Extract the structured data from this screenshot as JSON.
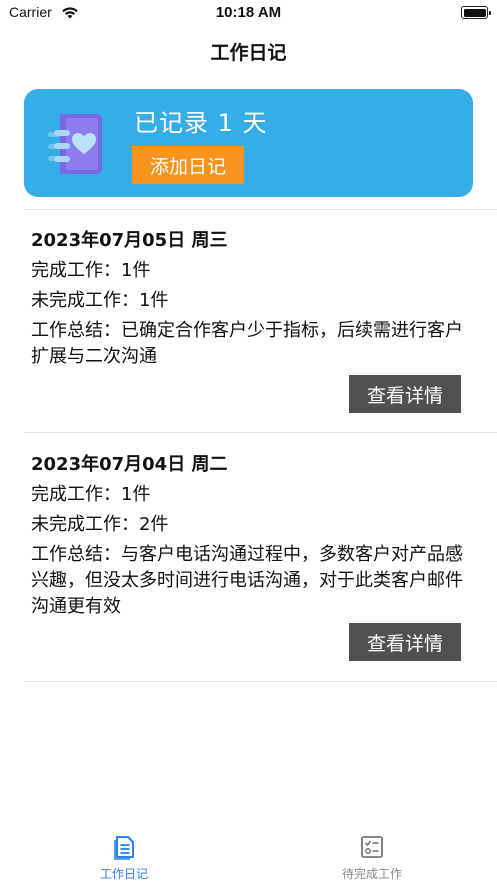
{
  "status_bar": {
    "carrier": "Carrier",
    "time": "10:18 AM"
  },
  "nav": {
    "title": "工作日记"
  },
  "banner": {
    "title": "已记录 1 天",
    "add_button": "添加日记",
    "icon": "notebook-heart-icon"
  },
  "entries": [
    {
      "date": "2023年07月05日 周三",
      "completed": "完成工作：1件",
      "uncompleted": "未完成工作：1件",
      "summary": "工作总结：已确定合作客户少于指标，后续需进行客户扩展与二次沟通",
      "detail_button": "查看详情"
    },
    {
      "date": "2023年07月04日 周二",
      "completed": "完成工作：1件",
      "uncompleted": "未完成工作：2件",
      "summary": "工作总结：与客户电话沟通过程中，多数客户对产品感兴趣，但没太多时间进行电话沟通，对于此类客户邮件沟通更有效",
      "detail_button": "查看详情"
    }
  ],
  "tabbar": {
    "tabs": [
      {
        "label": "工作日记",
        "icon": "diary-icon",
        "active": true
      },
      {
        "label": "待完成工作",
        "icon": "checklist-icon",
        "active": false
      }
    ]
  },
  "colors": {
    "banner_bg": "#35aee8",
    "add_button_bg": "#f7941d",
    "detail_button_bg": "#505050",
    "tab_active": "#2b7de9",
    "tab_inactive": "#888888"
  }
}
